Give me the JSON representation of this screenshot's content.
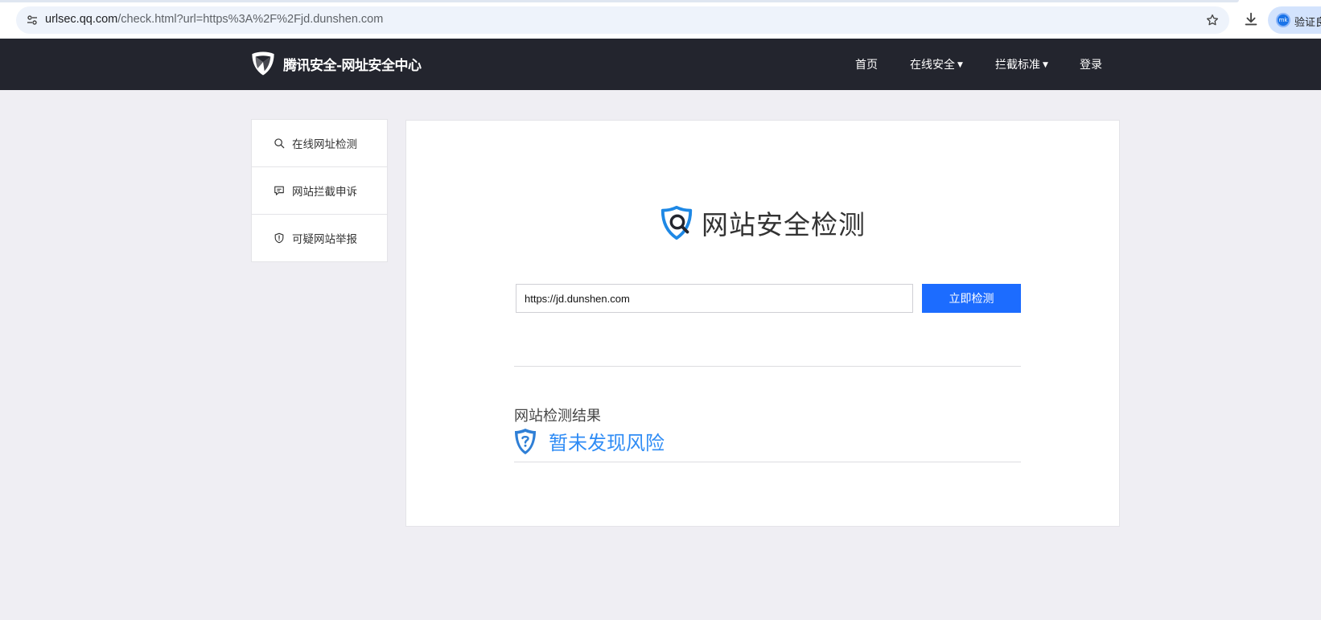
{
  "browser": {
    "url_host": "urlsec.qq.com",
    "url_path": "/check.html?url=https%3A%2F%2Fjd.dunshen.com",
    "profile_label": "验证良",
    "profile_avatar_text": "mk"
  },
  "header": {
    "logo_text": "腾讯安全-网址安全中心",
    "nav": {
      "home": "首页",
      "online_security": "在线安全",
      "block_standard": "拦截标准",
      "login": "登录"
    }
  },
  "sidebar": {
    "items": [
      {
        "label": "在线网址检测",
        "icon": "search-icon"
      },
      {
        "label": "网站拦截申诉",
        "icon": "comment-icon"
      },
      {
        "label": "可疑网站举报",
        "icon": "shield-alert-icon"
      }
    ]
  },
  "main": {
    "title": "网站安全检测",
    "input_value": "https://jd.dunshen.com",
    "check_button": "立即检测",
    "result_label": "网站检测结果",
    "result_status": "暂未发现风险"
  },
  "colors": {
    "header_bg": "#23252e",
    "accent_blue": "#1c6cff",
    "result_blue": "#2f8cf5",
    "page_bg": "#efeef3"
  }
}
